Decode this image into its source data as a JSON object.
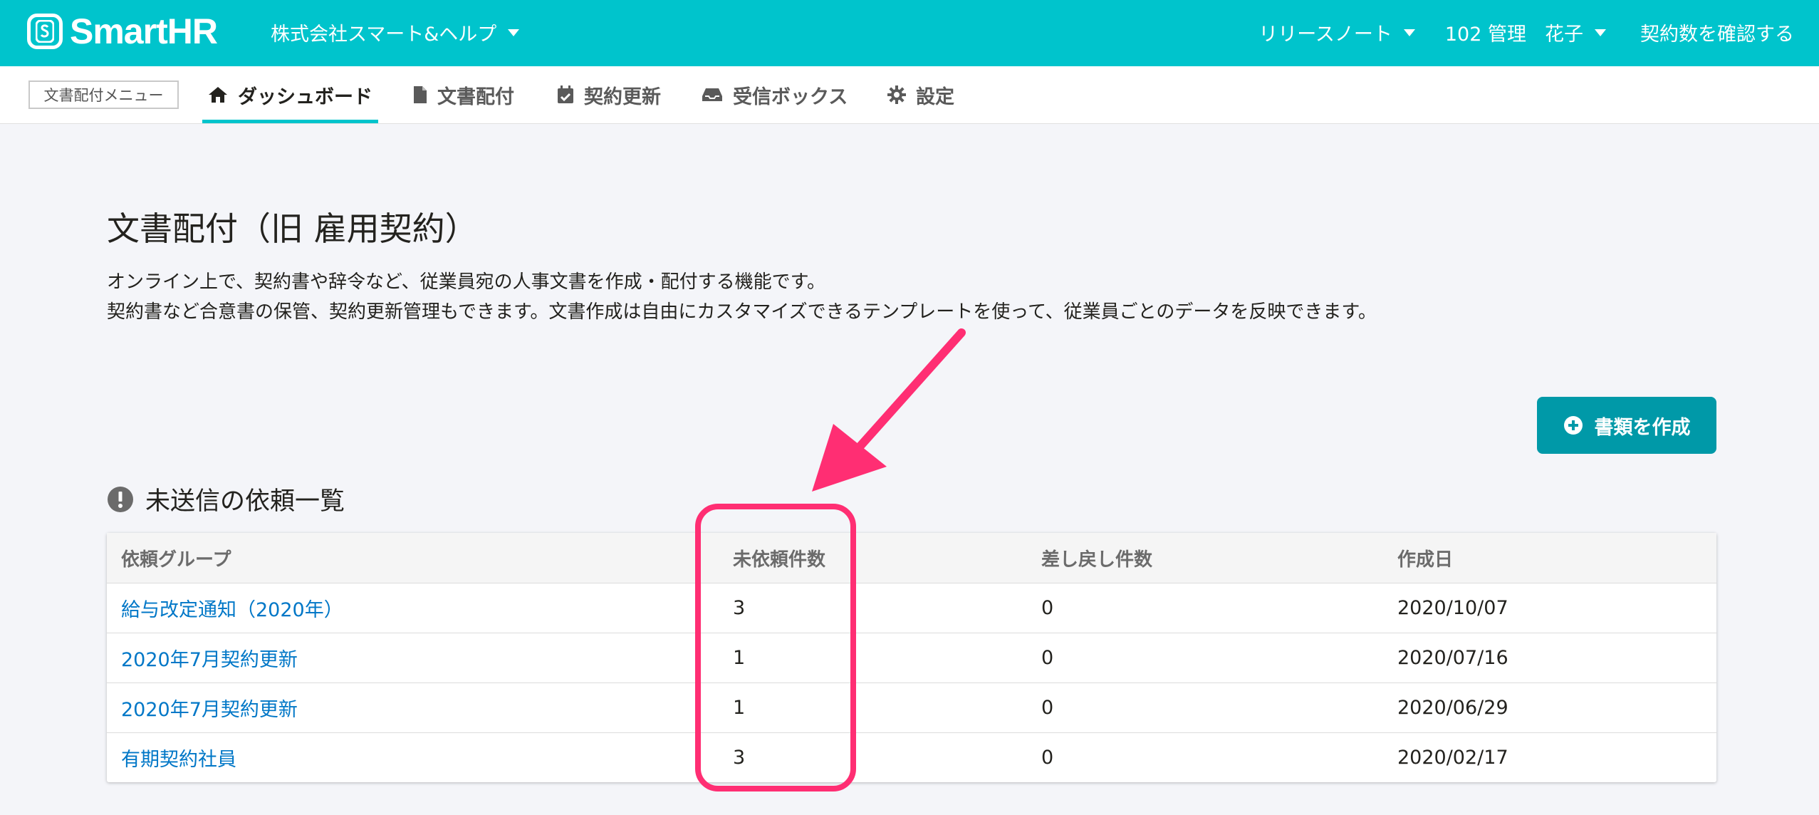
{
  "header": {
    "logo_text": "SmartHR",
    "tenant": "株式会社スマート&ヘルプ",
    "release_notes": "リリースノート",
    "user_id": "102 管理",
    "user_name": "花子",
    "contract_check": "契約数を確認する"
  },
  "subnav": {
    "menu_label": "文書配付メニュー",
    "tabs": [
      {
        "label": "ダッシュボード",
        "icon": "home-icon"
      },
      {
        "label": "文書配付",
        "icon": "document-icon"
      },
      {
        "label": "契約更新",
        "icon": "calendar-check-icon"
      },
      {
        "label": "受信ボックス",
        "icon": "inbox-icon"
      },
      {
        "label": "設定",
        "icon": "gear-icon"
      }
    ]
  },
  "main": {
    "title": "文書配付（旧 雇用契約）",
    "description_line1": "オンライン上で、契約書や辞令など、従業員宛の人事文書を作成・配付する機能です。",
    "description_line2": "契約書など合意書の保管、契約更新管理もできます。文書作成は自由にカスタマイズできるテンプレートを使って、従業員ごとのデータを反映できます。",
    "create_button": "書類を作成",
    "section_title": "未送信の依頼一覧",
    "table": {
      "headers": [
        "依頼グループ",
        "未依頼件数",
        "差し戻し件数",
        "作成日"
      ],
      "rows": [
        {
          "group": "給与改定通知（2020年）",
          "pending": "3",
          "returned": "0",
          "created": "2020/10/07"
        },
        {
          "group": "2020年7月契約更新",
          "pending": "1",
          "returned": "0",
          "created": "2020/07/16"
        },
        {
          "group": "2020年7月契約更新",
          "pending": "1",
          "returned": "0",
          "created": "2020/06/29"
        },
        {
          "group": "有期契約社員",
          "pending": "3",
          "returned": "0",
          "created": "2020/02/17"
        }
      ]
    }
  },
  "colors": {
    "brand": "#00c4cc",
    "button": "#0099a8",
    "link": "#0077c7",
    "annotation": "#ff2e73"
  }
}
